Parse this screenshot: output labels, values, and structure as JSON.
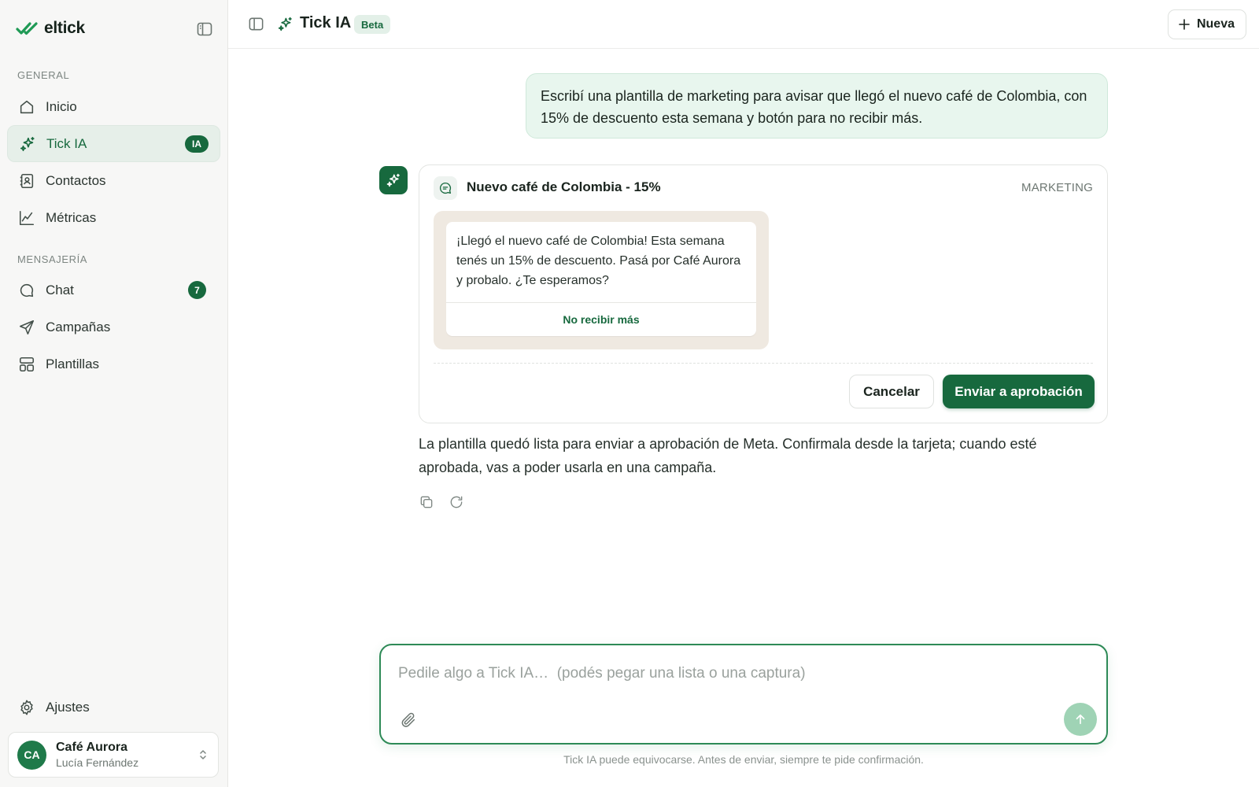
{
  "brand": {
    "name": "eltick"
  },
  "sidebar": {
    "sections": {
      "general": "GENERAL",
      "messaging": "MENSAJERÍA"
    },
    "items": [
      {
        "label": "Inicio"
      },
      {
        "label": "Tick IA",
        "badge": "IA"
      },
      {
        "label": "Contactos"
      },
      {
        "label": "Métricas"
      },
      {
        "label": "Chat",
        "count": "7"
      },
      {
        "label": "Campañas"
      },
      {
        "label": "Plantillas"
      },
      {
        "label": "Ajustes"
      }
    ],
    "account": {
      "initials": "CA",
      "business": "Café Aurora",
      "user": "Lucía Fernández"
    }
  },
  "header": {
    "title": "Tick IA",
    "badge": "Beta",
    "new_label": "Nueva"
  },
  "conversation": {
    "user_message": "Escribí una plantilla de marketing para avisar que llegó el nuevo café de Colombia, con 15% de descuento esta semana y botón para no recibir más.",
    "template": {
      "name": "Nuevo café de Colombia - 15%",
      "category": "MARKETING",
      "body": "¡Llegó el nuevo café de Colombia! Esta semana tenés un 15% de descuento. Pasá por Café Aurora y probalo. ¿Te esperamos?",
      "quick_reply": "No recibir más",
      "cancel_label": "Cancelar",
      "approve_label": "Enviar a aprobación"
    },
    "assistant_message": "La plantilla quedó lista para enviar a aprobación de Meta. Confirmala desde la tarjeta; cuando esté aprobada, vas a poder usarla en una campaña."
  },
  "composer": {
    "placeholder": "Pedile algo a Tick IA…  (podés pegar una lista o una captura)",
    "value": ""
  },
  "footer": {
    "disclaimer": "Tick IA puede equivocarse. Antes de enviar, siempre te pide confirmación."
  },
  "colors": {
    "accent": "#17693e",
    "user_bubble": "#e8f6ee",
    "preview_bg": "#efe9e1",
    "send_disabled": "#9fd3b5"
  },
  "icons": {
    "brand": "double-check-icon",
    "home": "home-icon",
    "ai": "sparkles-icon",
    "contacts": "contact-book-icon",
    "metrics": "line-chart-icon",
    "chat": "chat-bubble-icon",
    "campaigns": "paper-plane-icon",
    "templates": "layout-template-icon",
    "settings": "gear-icon"
  }
}
